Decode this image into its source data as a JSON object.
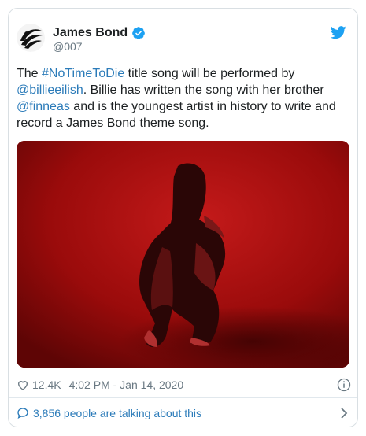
{
  "author": {
    "display_name": "James Bond",
    "handle": "@007"
  },
  "tweet": {
    "t1": "The ",
    "hashtag": "#NoTimeToDie",
    "t2": " title song will be performed by ",
    "mention1": "@billieeilish",
    "t3": ". Billie has written the song with her brother ",
    "mention2": "@finneas",
    "t4": " and is the youngest artist in history to write and record a James Bond theme song."
  },
  "meta": {
    "likes": "12.4K",
    "timestamp": "4:02 PM - Jan 14, 2020"
  },
  "footer": {
    "talking": "3,856 people are talking about this"
  },
  "colors": {
    "link": "#2b7bb9",
    "twitter_blue": "#1da1f2",
    "muted": "#697882",
    "media_red": "#9a0b0b"
  }
}
